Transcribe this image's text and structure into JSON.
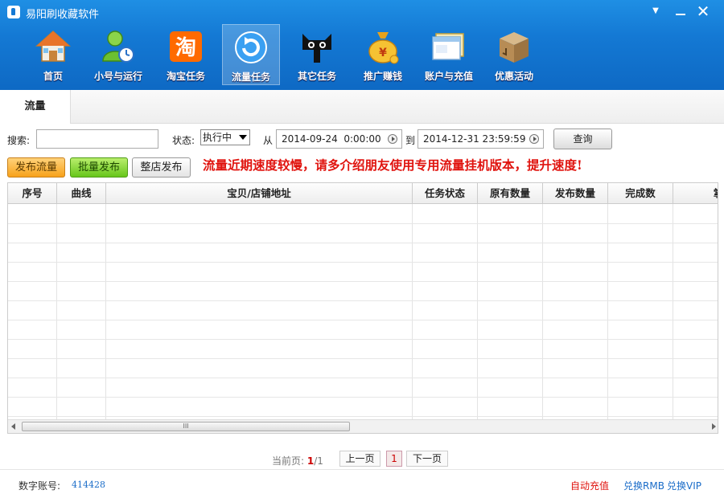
{
  "window": {
    "title": "易阳刷收藏软件"
  },
  "nav": [
    {
      "label": "首页",
      "icon": "house-icon"
    },
    {
      "label": "小号与运行",
      "icon": "user-clock-icon"
    },
    {
      "label": "淘宝任务",
      "icon": "taobao-icon",
      "glyph": "淘"
    },
    {
      "label": "流量任务",
      "icon": "refresh-circle-icon",
      "active": true
    },
    {
      "label": "其它任务",
      "icon": "tmall-cat-icon"
    },
    {
      "label": "推广赚钱",
      "icon": "money-bag-icon"
    },
    {
      "label": "账户与充值",
      "icon": "browser-window-icon"
    },
    {
      "label": "优惠活动",
      "icon": "gift-box-icon"
    }
  ],
  "tab": {
    "label": "流量"
  },
  "filter": {
    "search_label": "搜索:",
    "search_value": "",
    "status_label": "状态:",
    "status_value": "执行中",
    "from_label": "从",
    "from_date": "2014-09-24  0:00:00",
    "to_label": "到",
    "to_date": "2014-12-31 23:59:59",
    "query_label": "查询"
  },
  "actions": {
    "publish_traffic": "发布流量",
    "batch_publish": "批量发布",
    "store_publish": "整店发布"
  },
  "notice": "流量近期速度较慢，请多介绍朋友使用专用流量挂机版本，提升速度!",
  "table": {
    "columns": [
      "序号",
      "曲线",
      "宝贝/店铺地址",
      "任务状态",
      "原有数量",
      "发布数量",
      "完成数",
      "掌"
    ],
    "scroll_thumb": "III"
  },
  "pager": {
    "label": "当前页:",
    "current": "1",
    "separator": "/",
    "total": "1",
    "prev": "上一页",
    "page_num": "1",
    "next": "下一页"
  },
  "footer": {
    "account_label": "数字账号:",
    "account_value": "414428",
    "auto_recharge": "自动充值",
    "exchange_rmb": "兑换RMB",
    "exchange_vip": "兑换VIP"
  },
  "colors": {
    "toolbar_blue": "#1479d4",
    "notice_red": "#e0130e",
    "link_blue": "#1a6cc8"
  }
}
